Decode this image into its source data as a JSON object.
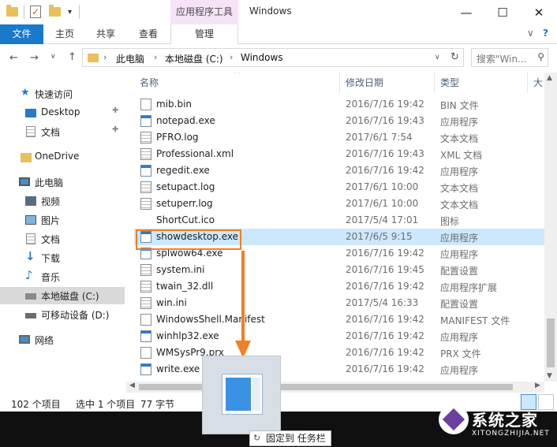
{
  "window": {
    "title": "Windows",
    "context_tab": "应用程序工具",
    "minimize": "—",
    "maximize": "☐",
    "close": "✕"
  },
  "ribbon": {
    "tabs": [
      "文件",
      "主页",
      "共享",
      "查看",
      "管理"
    ]
  },
  "address": {
    "crumbs": [
      "此电脑",
      "本地磁盘 (C:)",
      "Windows"
    ],
    "search_placeholder": "搜索\"Win...",
    "search_icon": "search-icon"
  },
  "nav": {
    "items": [
      {
        "label": "快速访问",
        "icon": "star-icon"
      },
      {
        "label": "Desktop",
        "icon": "desktop-icon",
        "pinned": true
      },
      {
        "label": "文档",
        "icon": "documents-icon",
        "pinned": true
      },
      {
        "label": "OneDrive",
        "icon": "onedrive-icon"
      },
      {
        "label": "此电脑",
        "icon": "computer-icon"
      },
      {
        "label": "视频",
        "icon": "videos-icon"
      },
      {
        "label": "图片",
        "icon": "pictures-icon"
      },
      {
        "label": "文档",
        "icon": "documents-icon"
      },
      {
        "label": "下载",
        "icon": "downloads-icon"
      },
      {
        "label": "音乐",
        "icon": "music-icon"
      },
      {
        "label": "本地磁盘 (C:)",
        "icon": "drive-icon",
        "selected": true
      },
      {
        "label": "可移动设备 (D:)",
        "icon": "usb-drive-icon"
      },
      {
        "label": "网络",
        "icon": "network-icon"
      }
    ]
  },
  "columns": {
    "name": "名称",
    "date": "修改日期",
    "type": "类型",
    "size": "大"
  },
  "files": [
    {
      "name": "mib.bin",
      "date": "2016/7/16 19:42",
      "type": "BIN 文件",
      "icon": "doc"
    },
    {
      "name": "notepad.exe",
      "date": "2016/7/16 19:43",
      "type": "应用程序",
      "icon": "exe"
    },
    {
      "name": "PFRO.log",
      "date": "2017/6/1 7:54",
      "type": "文本文档",
      "icon": "text"
    },
    {
      "name": "Professional.xml",
      "date": "2016/7/16 19:43",
      "type": "XML 文档",
      "icon": "text"
    },
    {
      "name": "regedit.exe",
      "date": "2016/7/16 19:42",
      "type": "应用程序",
      "icon": "exe"
    },
    {
      "name": "setupact.log",
      "date": "2017/6/1 10:00",
      "type": "文本文档",
      "icon": "text"
    },
    {
      "name": "setuperr.log",
      "date": "2017/6/1 10:00",
      "type": "文本文档",
      "icon": "text"
    },
    {
      "name": "ShortCut.ico",
      "date": "2017/5/4 17:01",
      "type": "图标",
      "icon": "none"
    },
    {
      "name": "showdesktop.exe",
      "date": "2017/6/5 9:15",
      "type": "应用程序",
      "icon": "exe",
      "selected": true
    },
    {
      "name": "splwow64.exe",
      "date": "2016/7/16 19:42",
      "type": "应用程序",
      "icon": "exe"
    },
    {
      "name": "system.ini",
      "date": "2016/7/16 19:45",
      "type": "配置设置",
      "icon": "text"
    },
    {
      "name": "twain_32.dll",
      "date": "2016/7/16 19:42",
      "type": "应用程序扩展",
      "icon": "text"
    },
    {
      "name": "win.ini",
      "date": "2017/5/4 16:33",
      "type": "配置设置",
      "icon": "text"
    },
    {
      "name": "WindowsShell.Manifest",
      "date": "2016/7/16 19:42",
      "type": "MANIFEST 文件",
      "icon": "doc"
    },
    {
      "name": "winhlp32.exe",
      "date": "2016/7/16 19:42",
      "type": "应用程序",
      "icon": "exe"
    },
    {
      "name": "WMSysPr9.prx",
      "date": "2016/7/16 19:42",
      "type": "PRX 文件",
      "icon": "doc"
    },
    {
      "name": "write.exe",
      "date": "2016/7/16 19:42",
      "type": "应用程序",
      "icon": "exe"
    }
  ],
  "status": {
    "count": "102 个项目",
    "selection": "选中 1 个项目",
    "size": "77 字节"
  },
  "taskbar": {
    "pin_tooltip": "固定到 任务栏"
  },
  "watermark": {
    "title": "系统之家",
    "subtitle": "XITONGZHIJIA.NET"
  }
}
